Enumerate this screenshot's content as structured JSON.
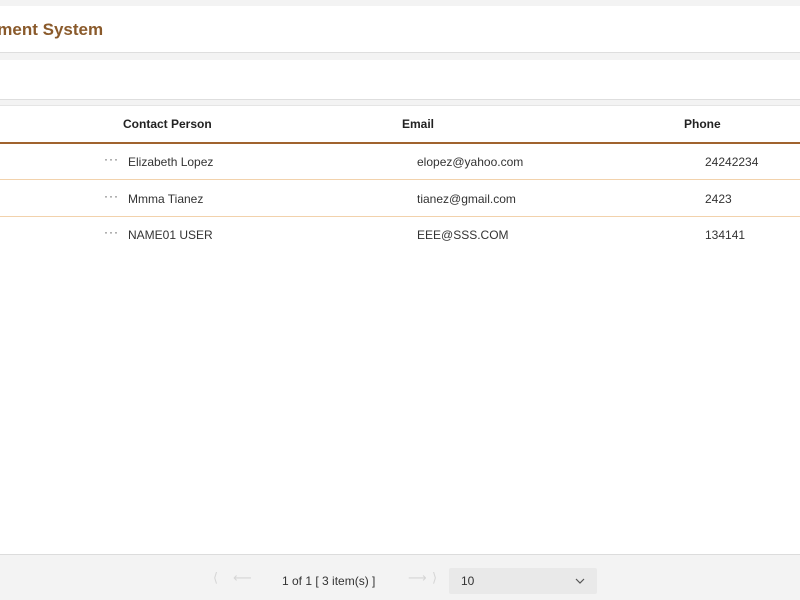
{
  "header": {
    "title": "agement System"
  },
  "grid": {
    "columns": [
      "Contact Person",
      "Email",
      "Phone"
    ],
    "rows": [
      {
        "actions": "···",
        "contact": "Elizabeth Lopez",
        "email": "elopez@yahoo.com",
        "phone": "24242234"
      },
      {
        "actions": "···",
        "contact": "Mmma Tianez",
        "email": "tianez@gmail.com",
        "phone": "2423"
      },
      {
        "actions": "···",
        "contact": "NAME01 USER",
        "email": "EEE@SSS.COM",
        "phone": "134141"
      }
    ]
  },
  "pager": {
    "first": "⟨",
    "prev": "⟵",
    "info": "1 of 1 [ 3 item(s) ]",
    "next": "⟶",
    "last": "⟩",
    "page_size": "10"
  },
  "colors": {
    "brand": "#8a5a2b",
    "header_rule": "#a0632e",
    "row_border": "#f2d2ac"
  },
  "icons": [
    "more-actions-icon",
    "chevron-down-icon",
    "first-page-icon",
    "prev-page-icon",
    "next-page-icon",
    "last-page-icon"
  ]
}
